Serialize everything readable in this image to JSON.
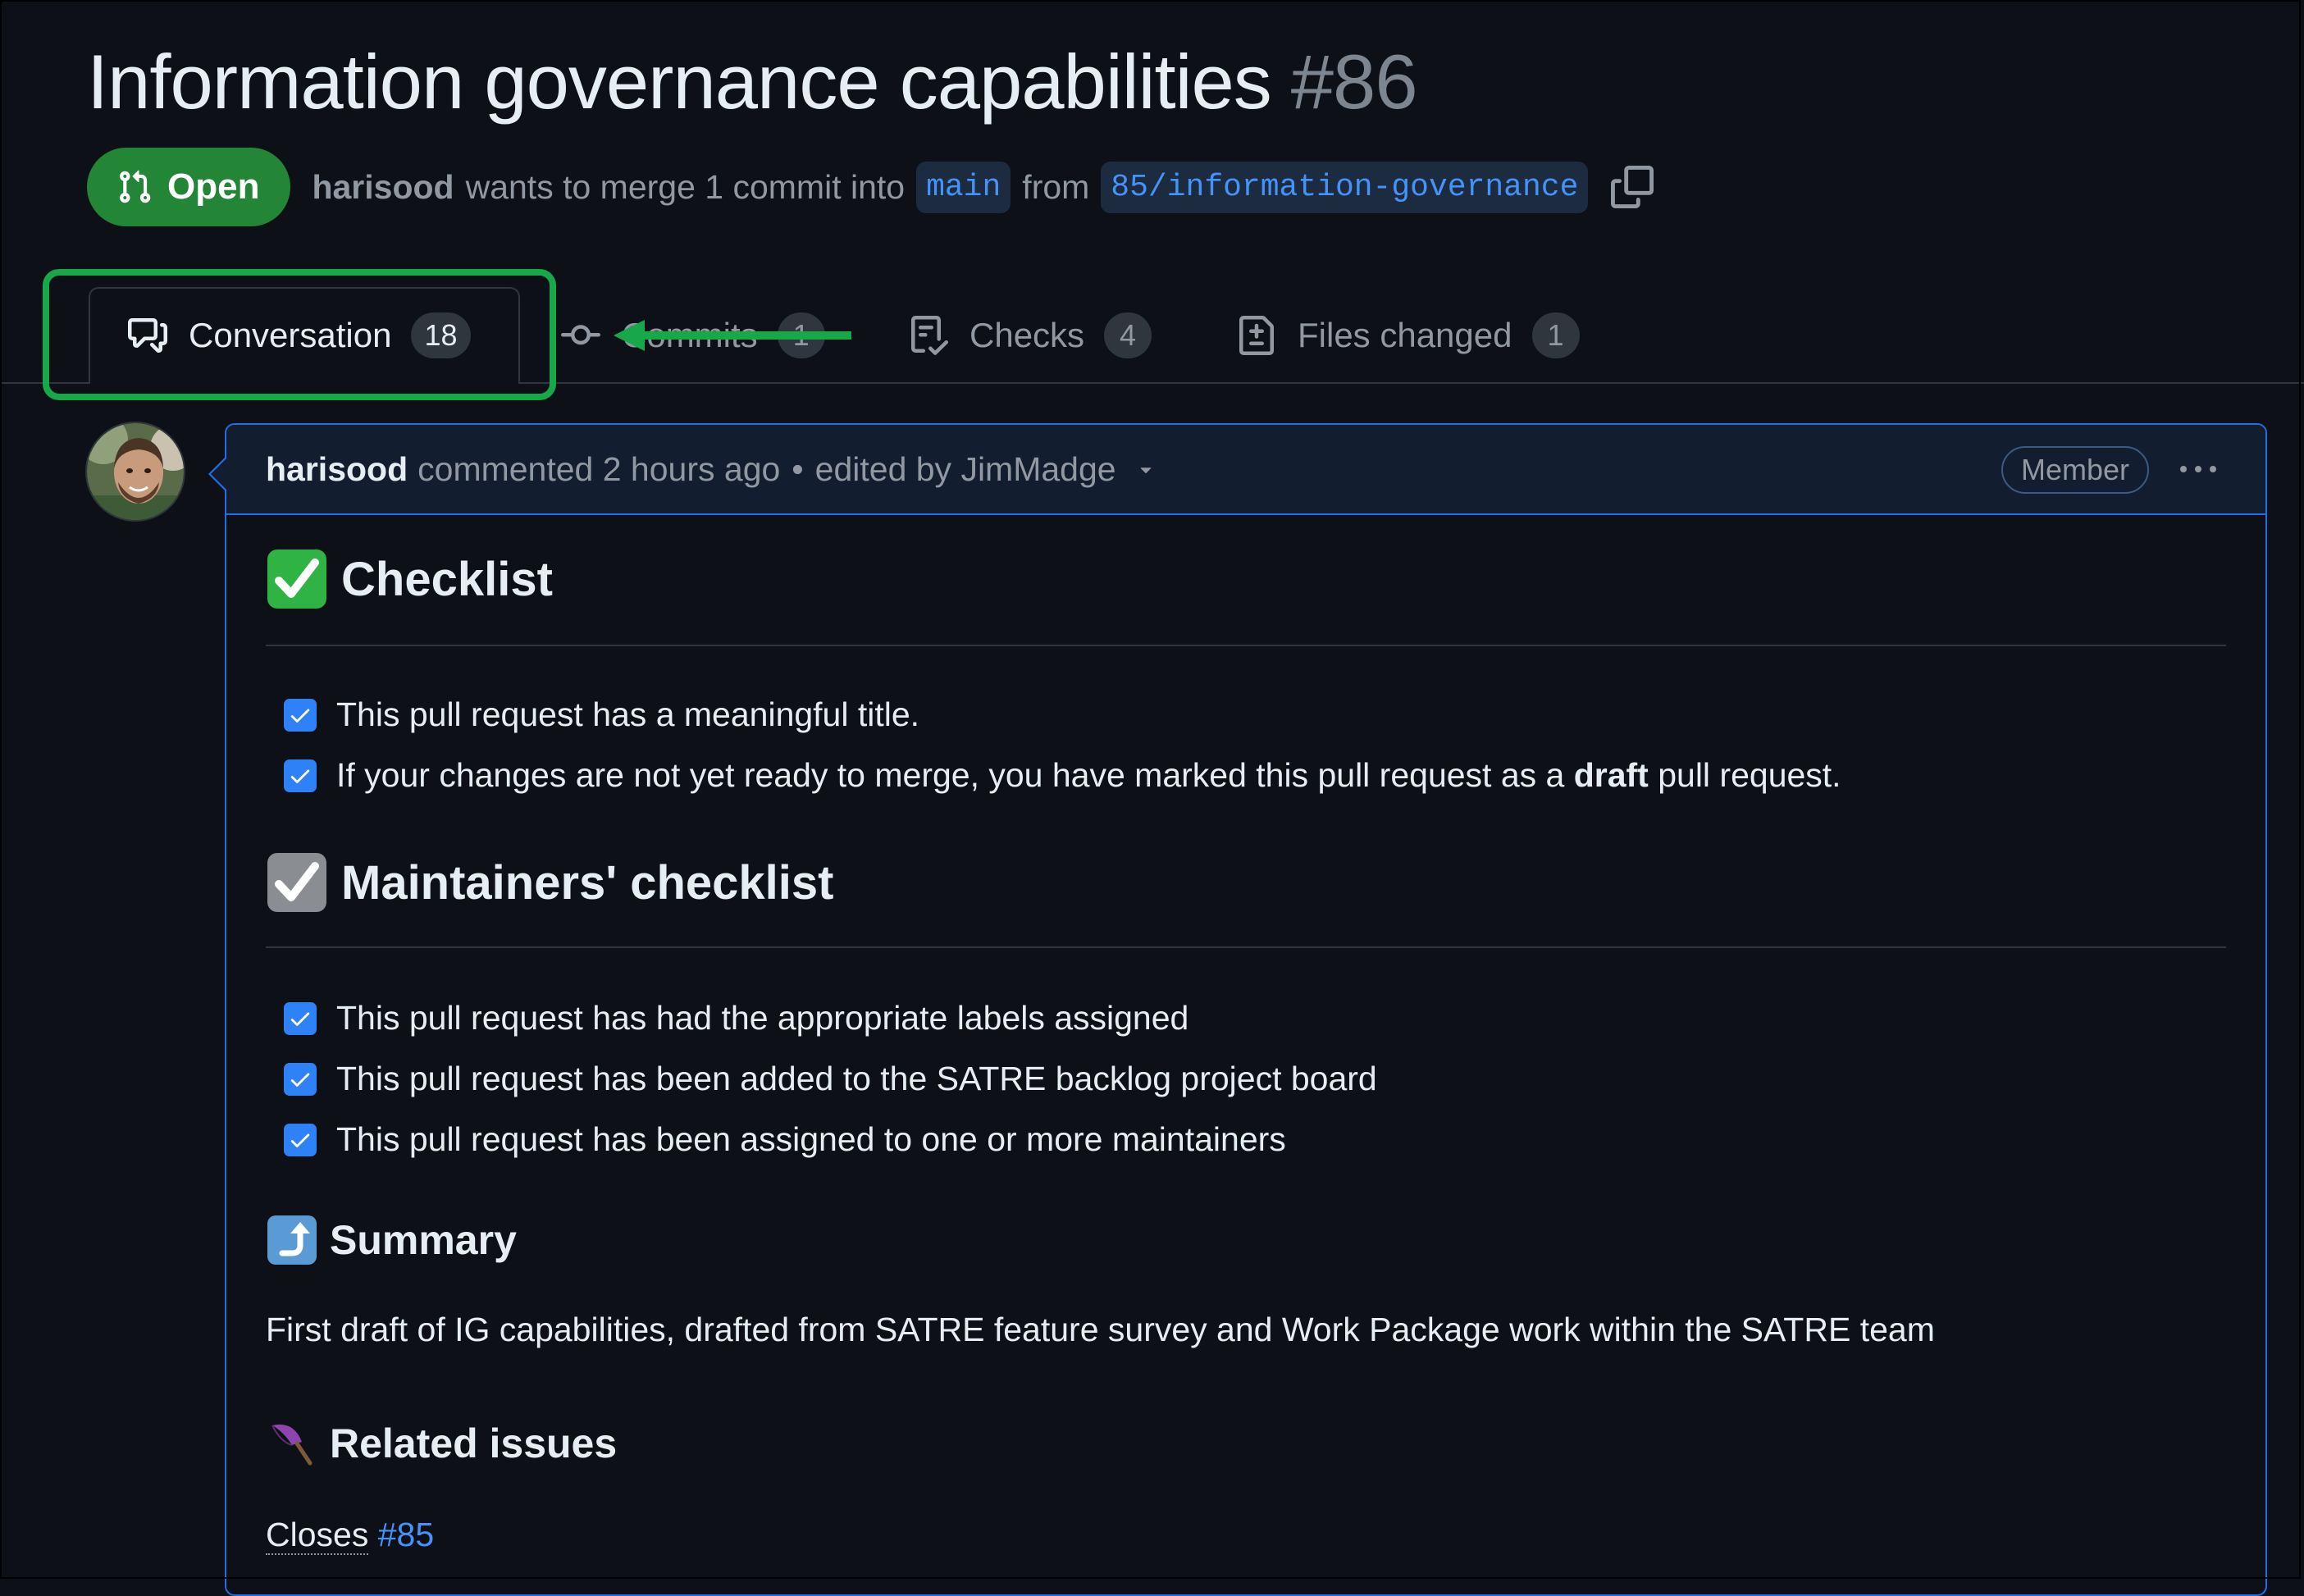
{
  "pr": {
    "title": "Information governance capabilities",
    "number": "#86",
    "state": "Open",
    "author": "harisood",
    "merge_text": "wants to merge 1 commit into",
    "base_branch": "main",
    "from_text": "from",
    "head_branch": "85/information-governance"
  },
  "tabs": [
    {
      "label": "Conversation",
      "count": "18",
      "icon": "comment-discussion-icon",
      "active": true
    },
    {
      "label": "Commits",
      "count": "1",
      "icon": "git-commit-icon",
      "active": false
    },
    {
      "label": "Checks",
      "count": "4",
      "icon": "checklist-icon",
      "active": false
    },
    {
      "label": "Files changed",
      "count": "1",
      "icon": "file-diff-icon",
      "active": false
    }
  ],
  "annotation": {
    "highlight_color": "#17a84a",
    "arrow_color": "#17a84a"
  },
  "comment": {
    "author": "harisood",
    "action": "commented 2 hours ago",
    "separator": "•",
    "edited": "edited by JimMadge",
    "role": "Member"
  },
  "body": {
    "checklist_heading": "Checklist",
    "checklist": [
      {
        "text": "This pull request has a meaningful title.",
        "checked": true
      },
      {
        "text_before": "If your changes are not yet ready to merge, you have marked this pull request as a ",
        "bold": "draft",
        "text_after": " pull request.",
        "checked": true
      }
    ],
    "maintainers_heading": "Maintainers' checklist",
    "maintainers": [
      {
        "text": "This pull request has had the appropriate labels assigned",
        "checked": true
      },
      {
        "text": "This pull request has been added to the SATRE backlog project board",
        "checked": true
      },
      {
        "text": "This pull request has been assigned to one or more maintainers",
        "checked": true
      }
    ],
    "summary_heading": "Summary",
    "summary_text": "First draft of IG capabilities, drafted from SATRE feature survey and Work Package work within the SATRE team",
    "related_heading": "Related issues",
    "closes_word": "Closes",
    "closes_issue": "#85"
  },
  "colors": {
    "accent": "#4493f8",
    "open_green": "#238636",
    "comment_border": "#1f6feb"
  }
}
